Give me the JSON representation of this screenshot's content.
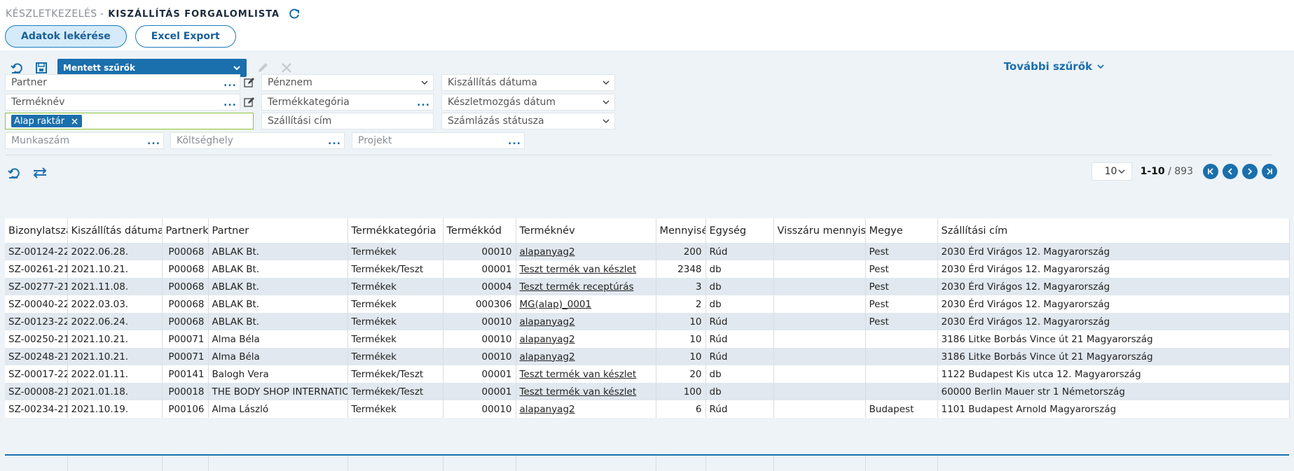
{
  "header": {
    "module": "Készletkezelés",
    "separator": "-",
    "title": "Kiszállítás forgalomlista"
  },
  "buttons": {
    "fetch": "Adatok lekérése",
    "excel": "Excel Export"
  },
  "toolbar": {
    "saved_filters": "Mentett szűrők",
    "more_filters": "További szűrők"
  },
  "filters": {
    "partner": "Partner",
    "currency": "Pénznem",
    "delivery_date": "Kiszállítás dátuma",
    "product_name": "Terméknév",
    "product_category": "Termékkategória",
    "stock_movement_date": "Készletmozgás dátum",
    "warehouse_tag": "Alap raktár",
    "shipping_address": "Szállítási cím",
    "billing_status": "Számlázás státusza",
    "job_number": "Munkaszám",
    "cost_center": "Költséghely",
    "project": "Projekt"
  },
  "pager": {
    "page_size": "10",
    "range": "1-10",
    "total": "/ 893"
  },
  "table": {
    "columns": [
      "Bizonylatszám",
      "Kiszállítás dátuma",
      "Partnerkód",
      "Partner",
      "Termékkategória",
      "Termékkód",
      "Terméknév",
      "Mennyiség",
      "Egység",
      "Visszáru mennyiség",
      "Megye",
      "Szállítási cím"
    ],
    "rows": [
      [
        "SZ-00124-22",
        "2022.06.28.",
        "P00068",
        "ABLAK Bt.",
        "Termékek",
        "00010",
        "alapanyag2",
        "200",
        "Rúd",
        "",
        "Pest",
        "2030 Érd Virágos 12. Magyarország"
      ],
      [
        "SZ-00261-21",
        "2021.10.21.",
        "P00068",
        "ABLAK Bt.",
        "Termékek/Teszt",
        "00001",
        "Teszt termék van készlet",
        "2348",
        "db",
        "",
        "Pest",
        "2030 Érd Virágos 12. Magyarország"
      ],
      [
        "SZ-00277-21",
        "2021.11.08.",
        "P00068",
        "ABLAK Bt.",
        "Termékek",
        "00004",
        "Teszt termék receptúrás",
        "3",
        "db",
        "",
        "Pest",
        "2030 Érd Virágos 12. Magyarország"
      ],
      [
        "SZ-00040-22",
        "2022.03.03.",
        "P00068",
        "ABLAK Bt.",
        "Termékek",
        "000306",
        "MG(alap)_0001",
        "2",
        "db",
        "",
        "Pest",
        "2030 Érd Virágos 12. Magyarország"
      ],
      [
        "SZ-00123-22",
        "2022.06.24.",
        "P00068",
        "ABLAK Bt.",
        "Termékek",
        "00010",
        "alapanyag2",
        "10",
        "Rúd",
        "",
        "Pest",
        "2030 Érd Virágos 12. Magyarország"
      ],
      [
        "SZ-00250-21",
        "2021.10.21.",
        "P00071",
        "Alma Béla",
        "Termékek",
        "00010",
        "alapanyag2",
        "10",
        "Rúd",
        "",
        "",
        "3186 Litke Borbás Vince út 21 Magyarország"
      ],
      [
        "SZ-00248-21",
        "2021.10.21.",
        "P00071",
        "Alma Béla",
        "Termékek",
        "00010",
        "alapanyag2",
        "10",
        "Rúd",
        "",
        "",
        "3186 Litke Borbás Vince út 21 Magyarország"
      ],
      [
        "SZ-00017-22",
        "2022.01.11.",
        "P00141",
        "Balogh Vera",
        "Termékek/Teszt",
        "00001",
        "Teszt termék van készlet",
        "20",
        "db",
        "",
        "",
        "1122 Budapest Kis utca 12. Magyarország"
      ],
      [
        "SZ-00008-21",
        "2021.01.18.",
        "P00018",
        "THE BODY SHOP INTERNATIONAL GMBH",
        "Termékek/Teszt",
        "00001",
        "Teszt termék van készlet",
        "100",
        "db",
        "",
        "",
        "60000 Berlin Mauer str 1 Németország"
      ],
      [
        "SZ-00234-21",
        "2021.10.19.",
        "P00106",
        "Alma László",
        "Termékek",
        "00010",
        "alapanyag2",
        "6",
        "Rúd",
        "",
        "Budapest",
        "1101 Budapest Arnold Magyarország"
      ]
    ]
  },
  "colors": {
    "accent": "#1a6fad",
    "row_alt": "#e1e8ef",
    "filter_bg": "#eef3f7",
    "tag_border": "#8cc63f"
  }
}
